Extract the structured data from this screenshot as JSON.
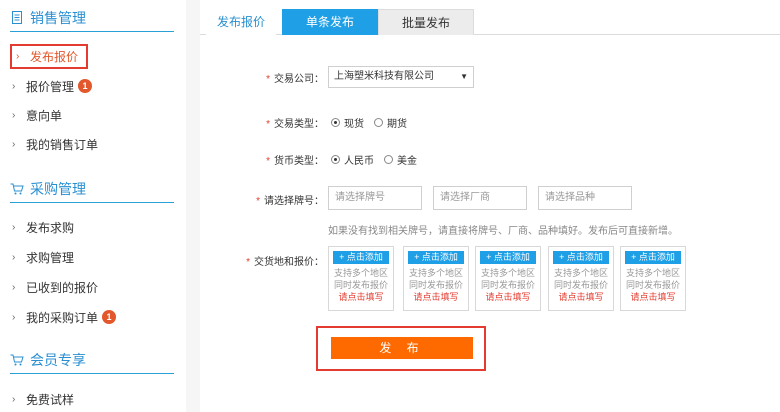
{
  "sidebar": {
    "sections": [
      {
        "title": "销售管理",
        "icon": "document-icon",
        "items": [
          {
            "label": "发布报价",
            "active": true
          },
          {
            "label": "报价管理",
            "badge": "1"
          },
          {
            "label": "意向单"
          },
          {
            "label": "我的销售订单"
          }
        ]
      },
      {
        "title": "采购管理",
        "icon": "cart-icon",
        "items": [
          {
            "label": "发布求购"
          },
          {
            "label": "求购管理"
          },
          {
            "label": "已收到的报价"
          },
          {
            "label": "我的采购订单",
            "badge": "1"
          }
        ]
      },
      {
        "title": "会员专享",
        "icon": "cart-icon",
        "items": [
          {
            "label": "免费试样"
          }
        ]
      }
    ]
  },
  "tabs": [
    "发布报价",
    "单条发布",
    "批量发布"
  ],
  "form": {
    "company": {
      "label": "交易公司：",
      "value": "上海塑米科技有限公司"
    },
    "trade_type": {
      "label": "交易类型：",
      "options": [
        "现货",
        "期货"
      ],
      "selected": "现货"
    },
    "currency": {
      "label": "货币类型：",
      "options": [
        "人民币",
        "美金"
      ],
      "selected": "人民币"
    },
    "grade": {
      "label": "请选择牌号：",
      "placeholders": [
        "请选择牌号",
        "请选择厂商",
        "请选择品种"
      ]
    },
    "hint": "如果没有找到相关牌号，请直接将牌号、厂商、品种填好。发布后可直接新增。",
    "delivery": {
      "label": "交货地和报价：",
      "add_label": "+ 点击添加",
      "line1": "支持多个地区",
      "line2": "同时发布报价",
      "line3": "请点击填写",
      "card_count": 5
    },
    "submit_label": "发 布"
  },
  "colors": {
    "accent": "#1e9fe6",
    "section_title": "#2a8fd0",
    "required": "#e33b2f",
    "publish": "#ff6a00",
    "badge": "#e2572b"
  }
}
